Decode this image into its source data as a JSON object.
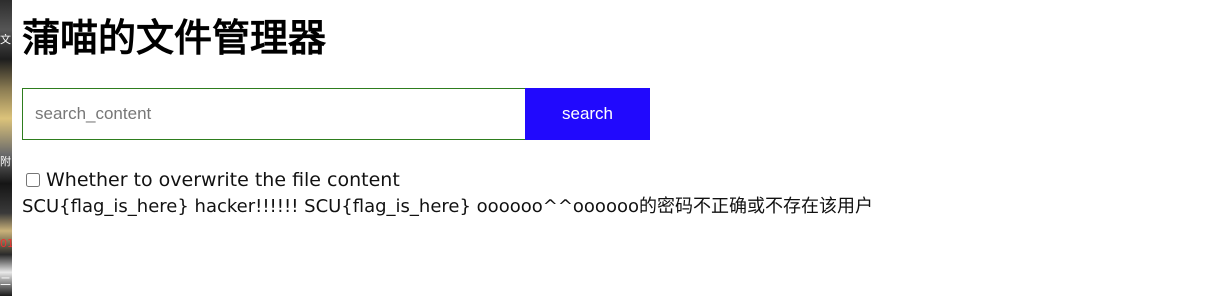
{
  "page": {
    "title": "蒲喵的文件管理器"
  },
  "search": {
    "placeholder": "search_content",
    "value": "",
    "button_label": "search"
  },
  "options": {
    "overwrite_label": "Whether to overwrite the file content",
    "overwrite_checked": false
  },
  "output": {
    "text": "SCU{flag_is_here} hacker!!!!!! SCU{flag_is_here} oooooo^^oooooo的密码不正确或不存在该用户"
  },
  "background_strip": {
    "fragments": [
      "文I",
      "附",
      "01",
      "二"
    ]
  },
  "colors": {
    "button_bg": "#2109fd",
    "input_border": "#2e7d1e"
  }
}
